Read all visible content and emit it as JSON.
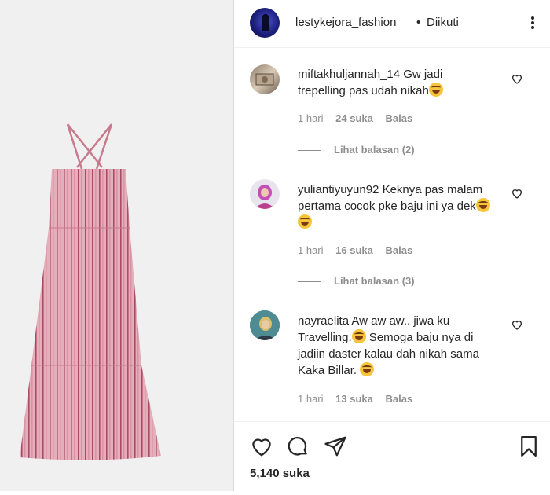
{
  "post": {
    "username": "lestykejora_fashion",
    "separator": "•",
    "follow_status": "Diikuti"
  },
  "comments": [
    {
      "username": "miftakhuljannah_14",
      "text": "Gw jadi trepelling pas udah nikah",
      "emoji_count": 1,
      "time": "1 hari",
      "likes": "24 suka",
      "reply": "Balas",
      "view_replies": "Lihat balasan (2)"
    },
    {
      "username": "yuliantiyuyun92",
      "text": "Keknya pas malam pertama cocok pke baju ini ya dek",
      "emoji_count": 2,
      "time": "1 hari",
      "likes": "16 suka",
      "reply": "Balas",
      "view_replies": "Lihat balasan (3)"
    },
    {
      "username": "nayraelita",
      "text_part1": "Aw aw aw.. jiwa ku Travelling.",
      "text_part2": " Semoga baju nya di jadiin daster kalau dah nikah sama Kaka Billar. ",
      "time": "1 hari",
      "likes": "13 suka",
      "reply": "Balas"
    }
  ],
  "footer": {
    "likes_count": "5,140 suka"
  },
  "colors": {
    "text": "#262626",
    "secondary": "#8e8e8e",
    "dress_pink": "#e3a8b6",
    "dress_stripe": "#b0526a"
  },
  "icons": [
    "more-options-icon",
    "heart-icon",
    "comment-icon",
    "share-icon",
    "bookmark-icon"
  ]
}
